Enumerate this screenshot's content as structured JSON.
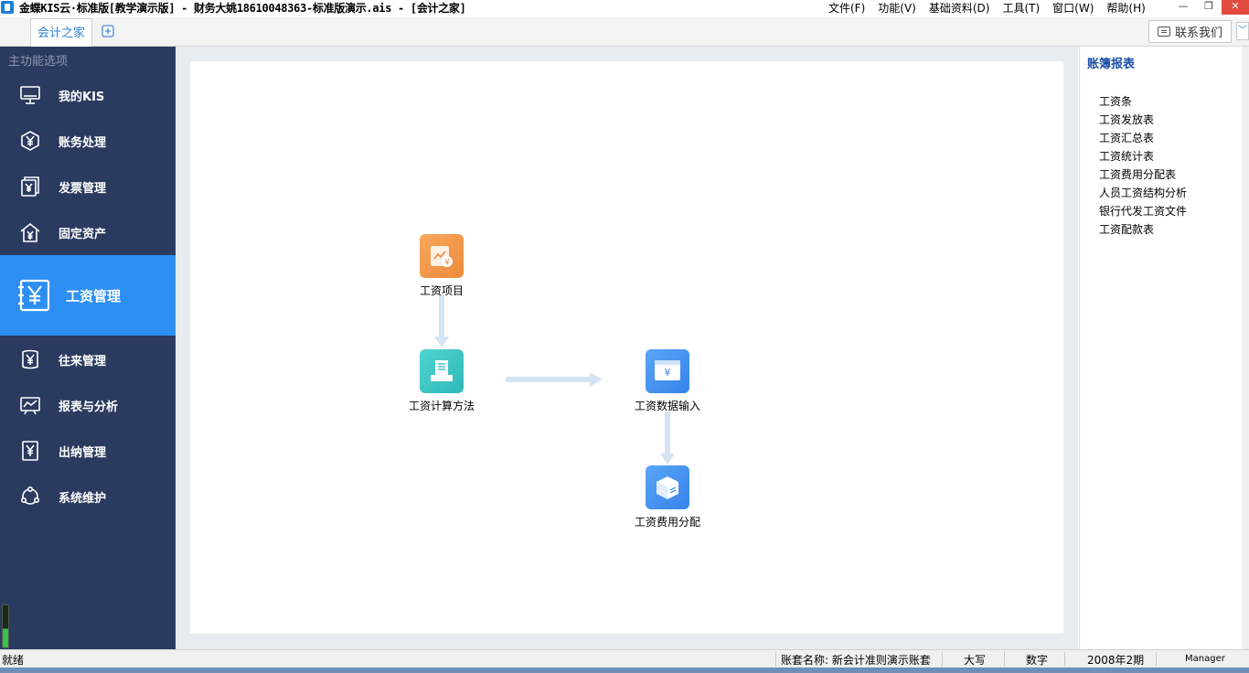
{
  "window": {
    "title": "金蝶KIS云·标准版[教学演示版] - 财务大姚18610048363-标准版演示.ais - [会计之家]",
    "menus": [
      "文件(F)",
      "功能(V)",
      "基础资料(D)",
      "工具(T)",
      "窗口(W)",
      "帮助(H)"
    ],
    "controls": {
      "minimize": "—",
      "restore": "❐",
      "close": "✕"
    }
  },
  "tabs": {
    "active": "会计之家",
    "add_icon": "plus-icon",
    "contact": "联系我们"
  },
  "sidebar": {
    "title": "主功能选项",
    "items": [
      {
        "label": "我的KIS",
        "icon": "monitor-icon"
      },
      {
        "label": "账务处理",
        "icon": "yen-hexagon-icon"
      },
      {
        "label": "发票管理",
        "icon": "invoice-icon"
      },
      {
        "label": "固定资产",
        "icon": "house-yen-icon"
      },
      {
        "label": "工资管理",
        "icon": "wage-book-icon",
        "active": true
      },
      {
        "label": "往来管理",
        "icon": "exchange-yen-icon"
      },
      {
        "label": "报表与分析",
        "icon": "chart-board-icon"
      },
      {
        "label": "出纳管理",
        "icon": "cashier-icon"
      },
      {
        "label": "系统维护",
        "icon": "maintenance-icon"
      }
    ]
  },
  "flow": {
    "nodes": [
      {
        "label": "工资项目",
        "color": "#f39a4c"
      },
      {
        "label": "工资计算方法",
        "color": "#3ec6c4"
      },
      {
        "label": "工资数据输入",
        "color": "#3c8ef0"
      },
      {
        "label": "工资费用分配",
        "color": "#3c8ef0"
      }
    ]
  },
  "right_panel": {
    "title": "账簿报表",
    "items": [
      "工资条",
      "工资发放表",
      "工资汇总表",
      "工资统计表",
      "工资费用分配表",
      "人员工资结构分析",
      "银行代发工资文件",
      "工资配款表"
    ]
  },
  "status": {
    "ready": "就绪",
    "account": "账套名称: 新会计准则演示账套",
    "caps": "大写",
    "num": "数字",
    "period": "2008年2期",
    "user": "Manager"
  }
}
